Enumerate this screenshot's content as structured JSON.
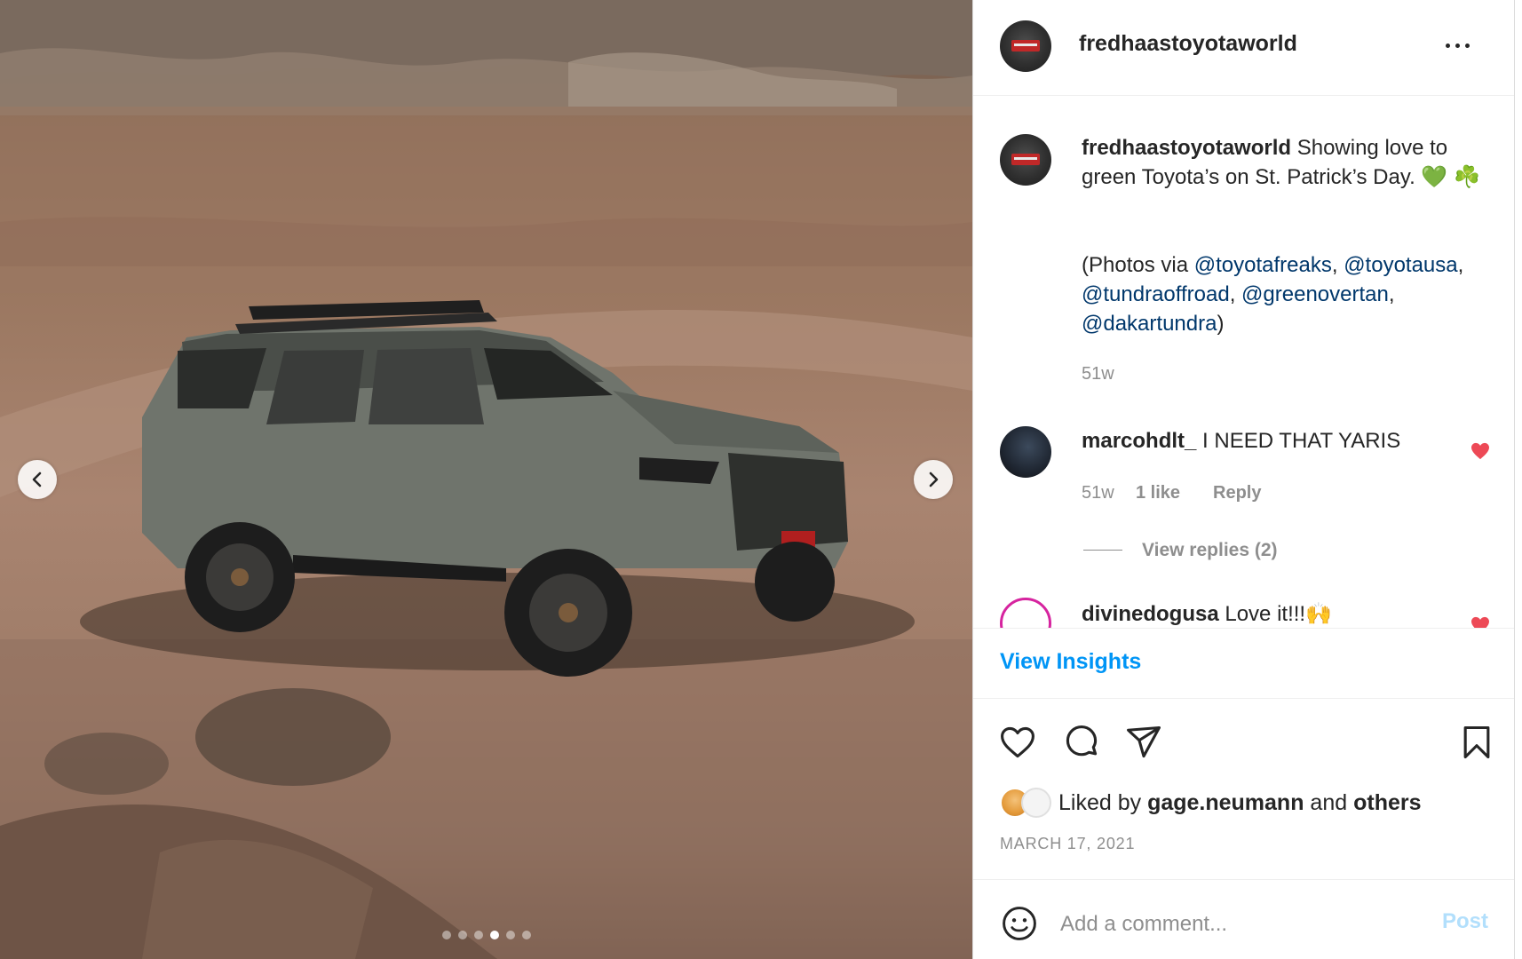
{
  "header": {
    "username": "fredhaastoyotaworld",
    "more_icon": "more-horizontal-icon"
  },
  "caption": {
    "username": "fredhaastoyotaworld",
    "text_1": " Showing love to green Toyota’s on St. Patrick’s Day. 💚 ☘️",
    "text_2_prefix": "(Photos via ",
    "mentions": [
      "@toyotafreaks",
      "@toyotausa",
      "@tundraoffroad",
      "@greenovertan",
      "@dakartundra"
    ],
    "sep": ", ",
    "suffix": ")",
    "time": "51w"
  },
  "comments": [
    {
      "username": "marcohdlt_",
      "text": " I NEED THAT YARIS",
      "time": "51w",
      "likes": "1 like",
      "reply": "Reply",
      "view_replies": "View replies (2)"
    },
    {
      "username": "divinedogusa",
      "text": " Love it!!!🙌"
    }
  ],
  "insights": "View Insights",
  "liked_by": {
    "prefix": "Liked by ",
    "user": "gage.neumann",
    "middle": " and ",
    "others": "others"
  },
  "date": "MARCH 17, 2021",
  "comment_box": {
    "placeholder": "Add a comment...",
    "post_label": "Post"
  },
  "carousel": {
    "dots_count": 6,
    "active_index": 3
  },
  "colors": {
    "link": "#00376b",
    "accent": "#0095f6",
    "heart": "#ed4956",
    "muted": "#8e8e8e"
  }
}
